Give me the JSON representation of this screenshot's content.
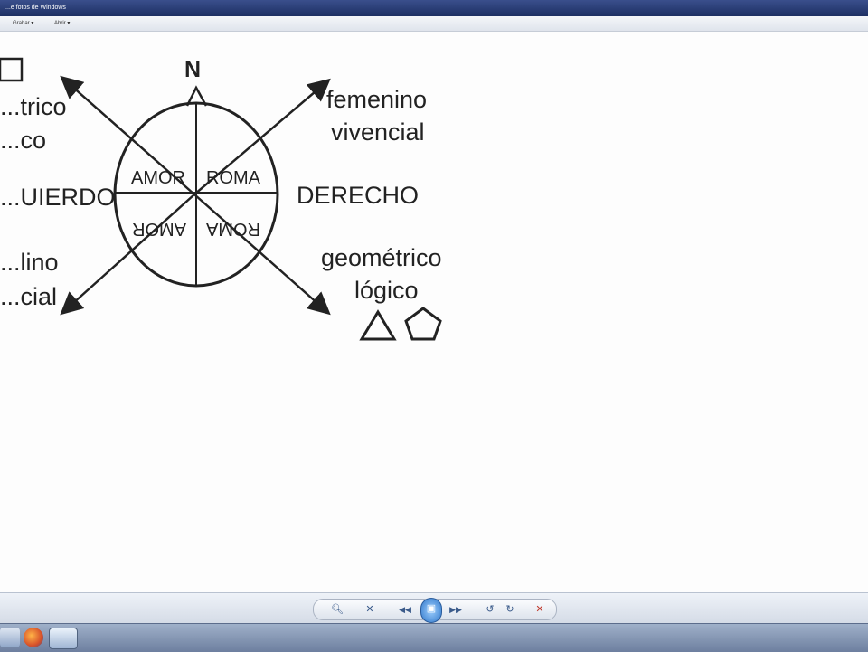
{
  "window": {
    "title": "...e fotos de Windows"
  },
  "menu": {
    "items": [
      "Grabar ▾",
      "Abrir ▾"
    ]
  },
  "diagram": {
    "north_label": "N",
    "top_left_lines": [
      "...trico",
      "...co"
    ],
    "top_right_lines": [
      "femenino",
      "vivencial"
    ],
    "left_label": "...UIERDO",
    "right_label": "DERECHO",
    "bottom_left_lines": [
      "...lino",
      "...cial"
    ],
    "bottom_right_lines": [
      "geométrico",
      "lógico"
    ],
    "quadrant_top_left": "AMOR",
    "quadrant_top_right": "ROMA",
    "quadrant_bottom_left": "AMOR",
    "quadrant_bottom_right": "ROMA"
  },
  "controls": {
    "zoom_icon": "magnifier-icon",
    "fit_icon": "fit-icon",
    "prev_icon": "previous-icon",
    "slideshow_icon": "slideshow-icon",
    "next_icon": "next-icon",
    "rotate_left_icon": "rotate-ccw-icon",
    "rotate_right_icon": "rotate-cw-icon",
    "delete_icon": "delete-icon"
  }
}
